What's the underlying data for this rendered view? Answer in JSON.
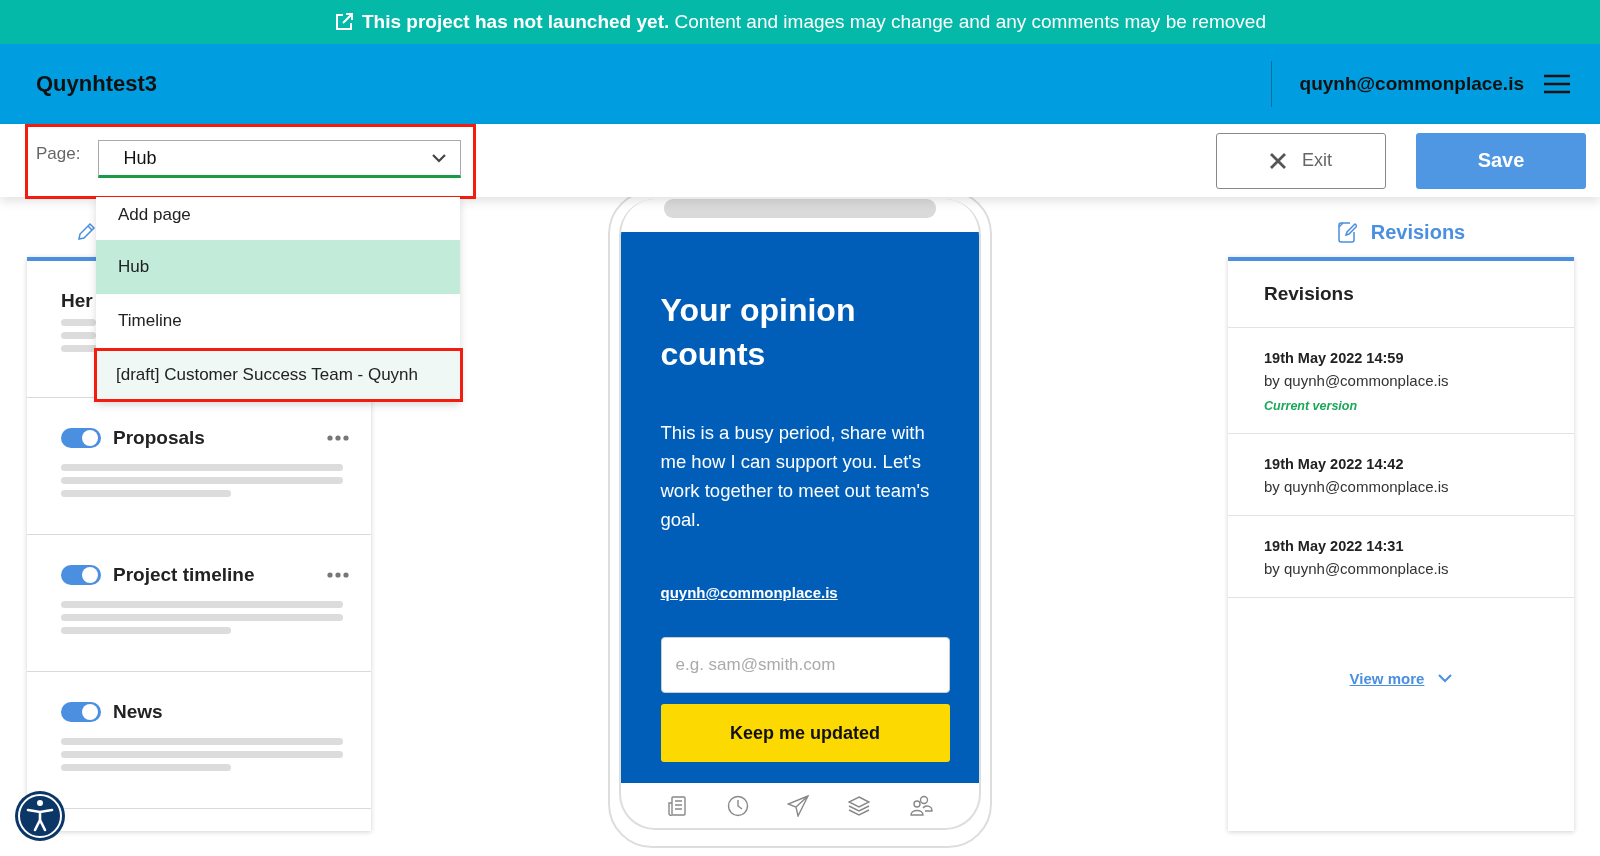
{
  "banner": {
    "message": "**This project has not launched yet.** Content and images may change and any comments may be removed"
  },
  "header": {
    "project": "Quynhtest3",
    "user": "quynh@commonplace.is"
  },
  "toolbar": {
    "page_label": "Page:",
    "page_value": "Hub",
    "annotated": true,
    "exit": "Exit",
    "save": "Save"
  },
  "page_menu": [
    {
      "label": "Add page",
      "selected": false,
      "hovered": false,
      "annotated": false
    },
    {
      "label": "Hub",
      "selected": true,
      "hovered": false,
      "annotated": false
    },
    {
      "label": "Timeline",
      "selected": false,
      "hovered": false,
      "annotated": false
    },
    {
      "label": "[draft] Customer Success Team - Quynh",
      "selected": false,
      "hovered": true,
      "annotated": true
    }
  ],
  "sections": [
    {
      "kind": "heading",
      "title": "Her"
    },
    {
      "kind": "toggle",
      "title": "Proposals",
      "on": true,
      "has_menu": true
    },
    {
      "kind": "toggle",
      "title": "Project timeline",
      "on": true,
      "has_menu": true
    },
    {
      "kind": "toggle",
      "title": "News",
      "on": true,
      "has_menu": false
    }
  ],
  "preview": {
    "heading": "Your opinion counts",
    "body": "This is a busy period, share with me how I can support you. Let's work together to meet out team's goal.",
    "link": "quynh@commonplace.is",
    "email_placeholder": "e.g. sam@smith.com",
    "button": "Keep me updated"
  },
  "revisions": {
    "tab": "Revisions",
    "title": "Revisions",
    "items": [
      {
        "date": "19th May 2022 14:59",
        "author": "by quynh@commonplace.is",
        "note": "Current version"
      },
      {
        "date": "19th May 2022 14:42",
        "author": "by quynh@commonplace.is"
      },
      {
        "date": "19th May 2022 14:31",
        "author": "by quynh@commonplace.is"
      }
    ],
    "view_more": "View more"
  }
}
